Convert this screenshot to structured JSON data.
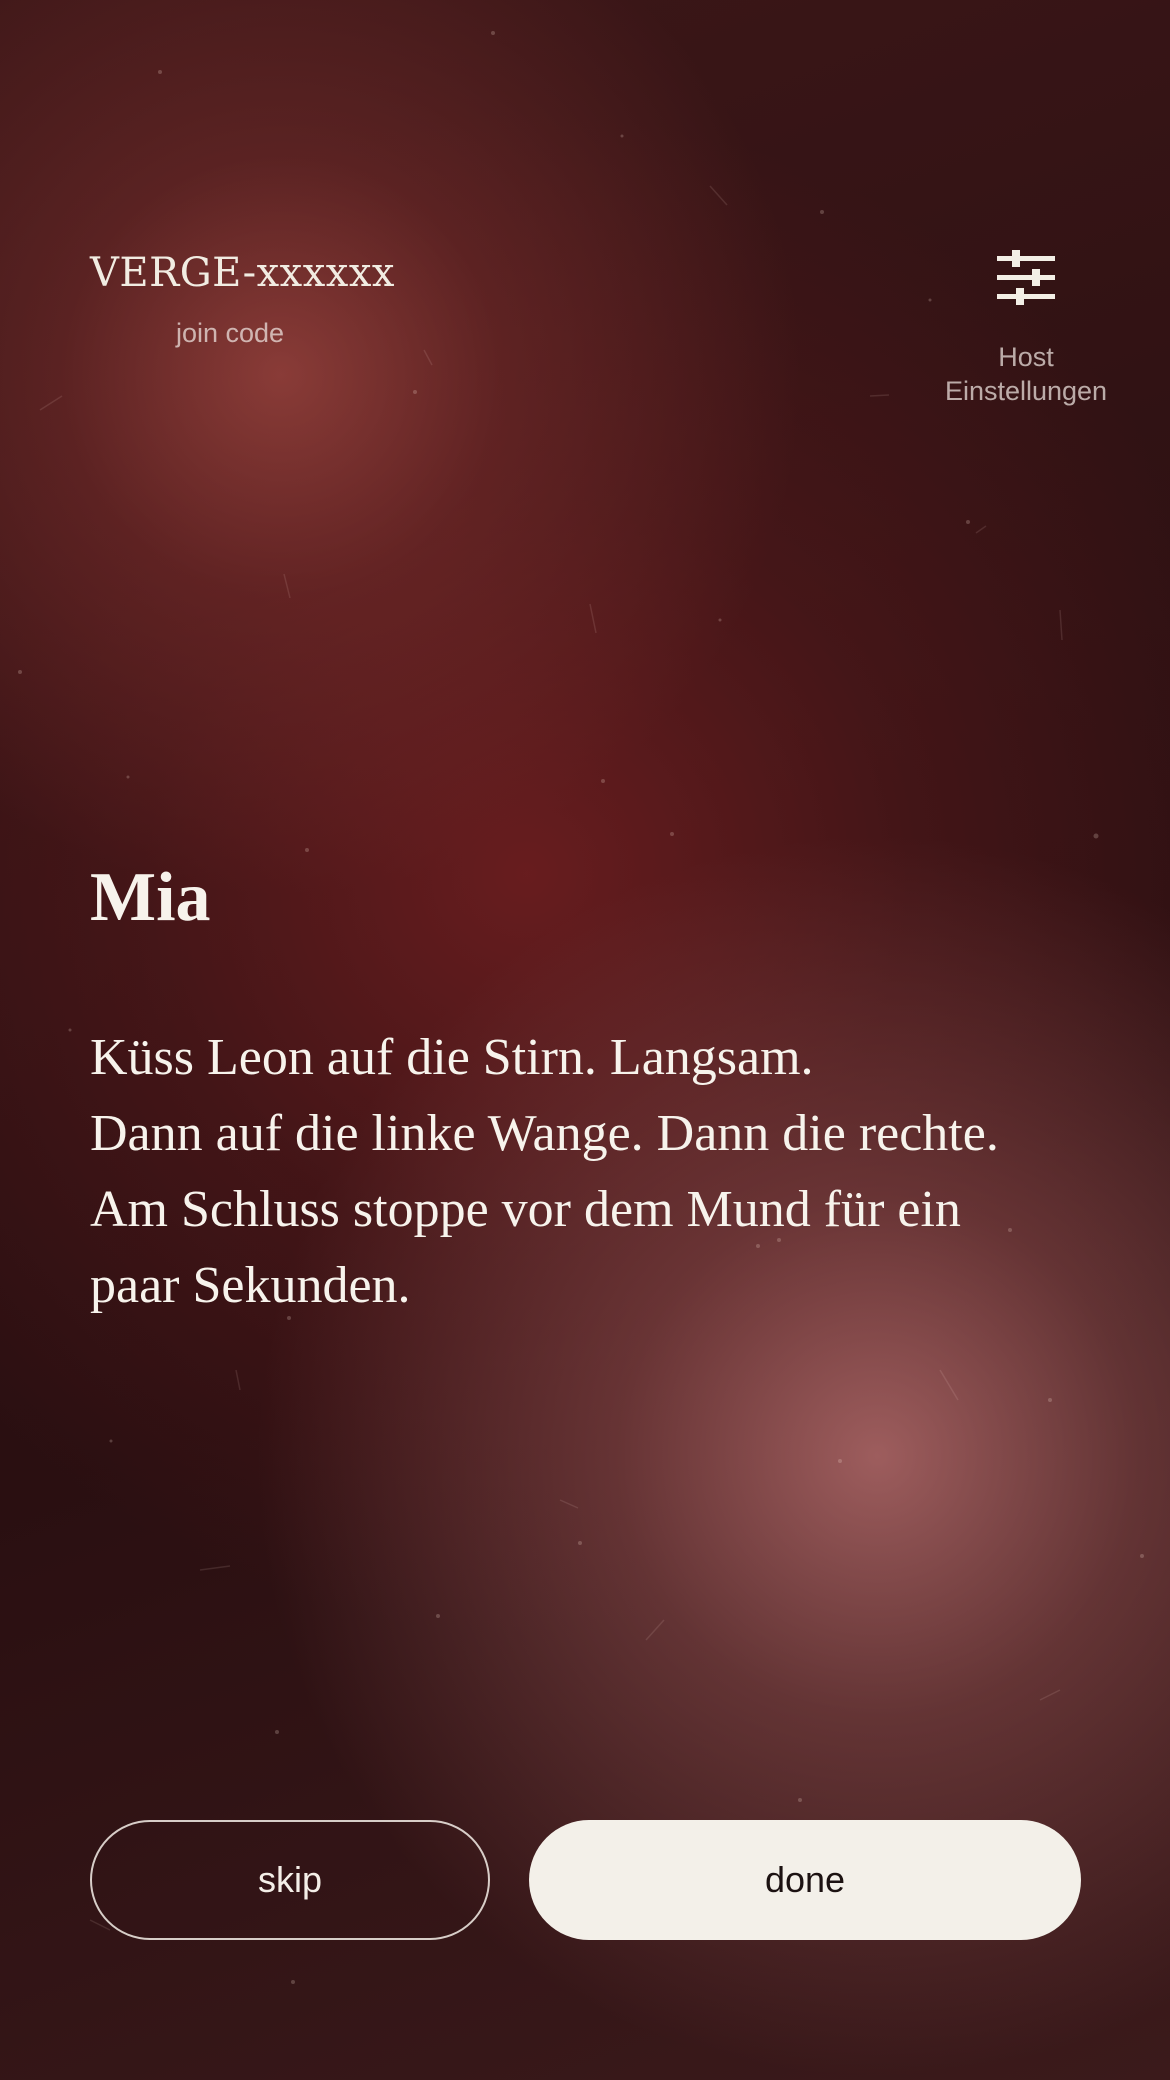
{
  "header": {
    "join_code": "VERGE-xxxxxx",
    "join_label": "join code",
    "host_icon": "sliders-icon",
    "host_label_line1": "Host",
    "host_label_line2": "Einstellungen"
  },
  "card": {
    "player_name": "Mia",
    "dare_lines": [
      "Küss Leon auf die Stirn. Langsam.",
      "Dann auf die linke Wange. Dann die rechte.",
      "Am Schluss stoppe vor dem Mund für ein",
      "paar Sekunden."
    ]
  },
  "actions": {
    "skip_label": "skip",
    "done_label": "done"
  },
  "colors": {
    "background": "#2a1012",
    "text": "#f3efe6",
    "done_button_bg": "#f3f0e9"
  }
}
